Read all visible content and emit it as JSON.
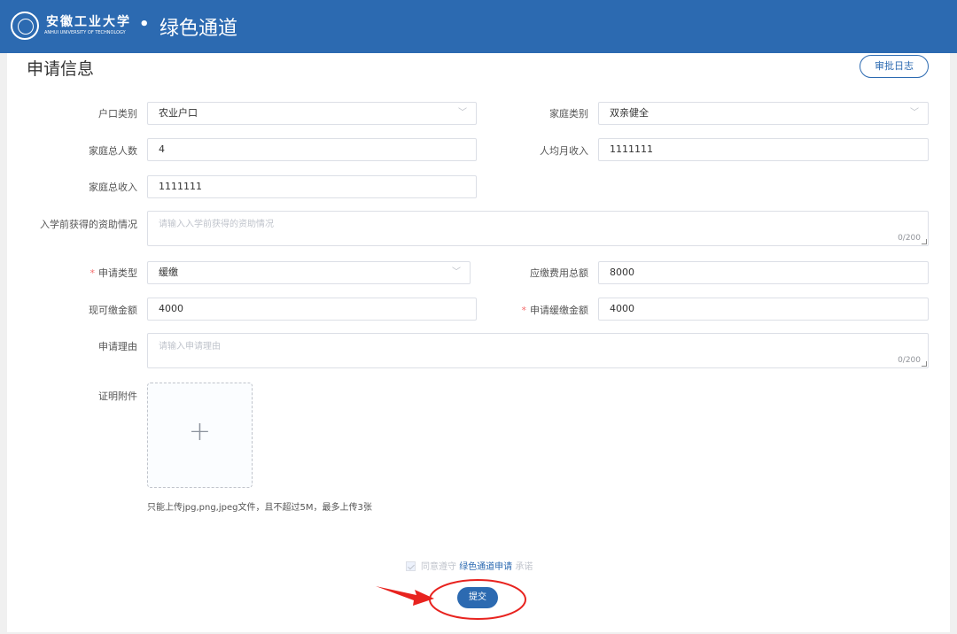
{
  "header": {
    "university_cn": "安徽工业大学",
    "university_en": "ANHUI UNIVERSITY OF TECHNOLOGY",
    "separator": "•",
    "system_title": "绿色通道"
  },
  "page": {
    "section_title": "申请信息",
    "log_button": "审批日志"
  },
  "form": {
    "household_type": {
      "label": "户口类别",
      "value": "农业户口"
    },
    "family_type": {
      "label": "家庭类别",
      "value": "双亲健全"
    },
    "family_size": {
      "label": "家庭总人数",
      "value": "4"
    },
    "monthly_income": {
      "label": "人均月收入",
      "value": "1111111"
    },
    "total_income": {
      "label": "家庭总收入",
      "value": "1111111"
    },
    "prior_aid": {
      "label": "入学前获得的资助情况",
      "placeholder": "请输入入学前获得的资助情况",
      "counter": "0/200"
    },
    "apply_type": {
      "required_mark": "*",
      "label": "申请类型",
      "value": "缓缴"
    },
    "fee_total": {
      "label": "应缴费用总额",
      "value": "8000"
    },
    "payable_now": {
      "label": "现可缴金额",
      "value": "4000"
    },
    "deferred_amount": {
      "required_mark": "*",
      "label": "申请缓缴金额",
      "value": "4000"
    },
    "reason": {
      "label": "申请理由",
      "placeholder": "请输入申请理由",
      "counter": "0/200"
    },
    "attachment": {
      "label": "证明附件",
      "tip": "只能上传jpg,png,jpeg文件，且不超过5M，最多上传3张"
    }
  },
  "agreement": {
    "prefix": "同意遵守",
    "link": "绿色通道申请",
    "suffix": "承诺"
  },
  "submit_label": "提交",
  "icons": {
    "select_chevron": "chevron-down-icon",
    "upload": "plus-icon",
    "logo": "university-seal-icon",
    "annotation_arrow": "red-arrow-icon"
  },
  "colors": {
    "primary": "#2c6ab1",
    "required": "#f56c6c",
    "annotation": "#e8231f"
  }
}
